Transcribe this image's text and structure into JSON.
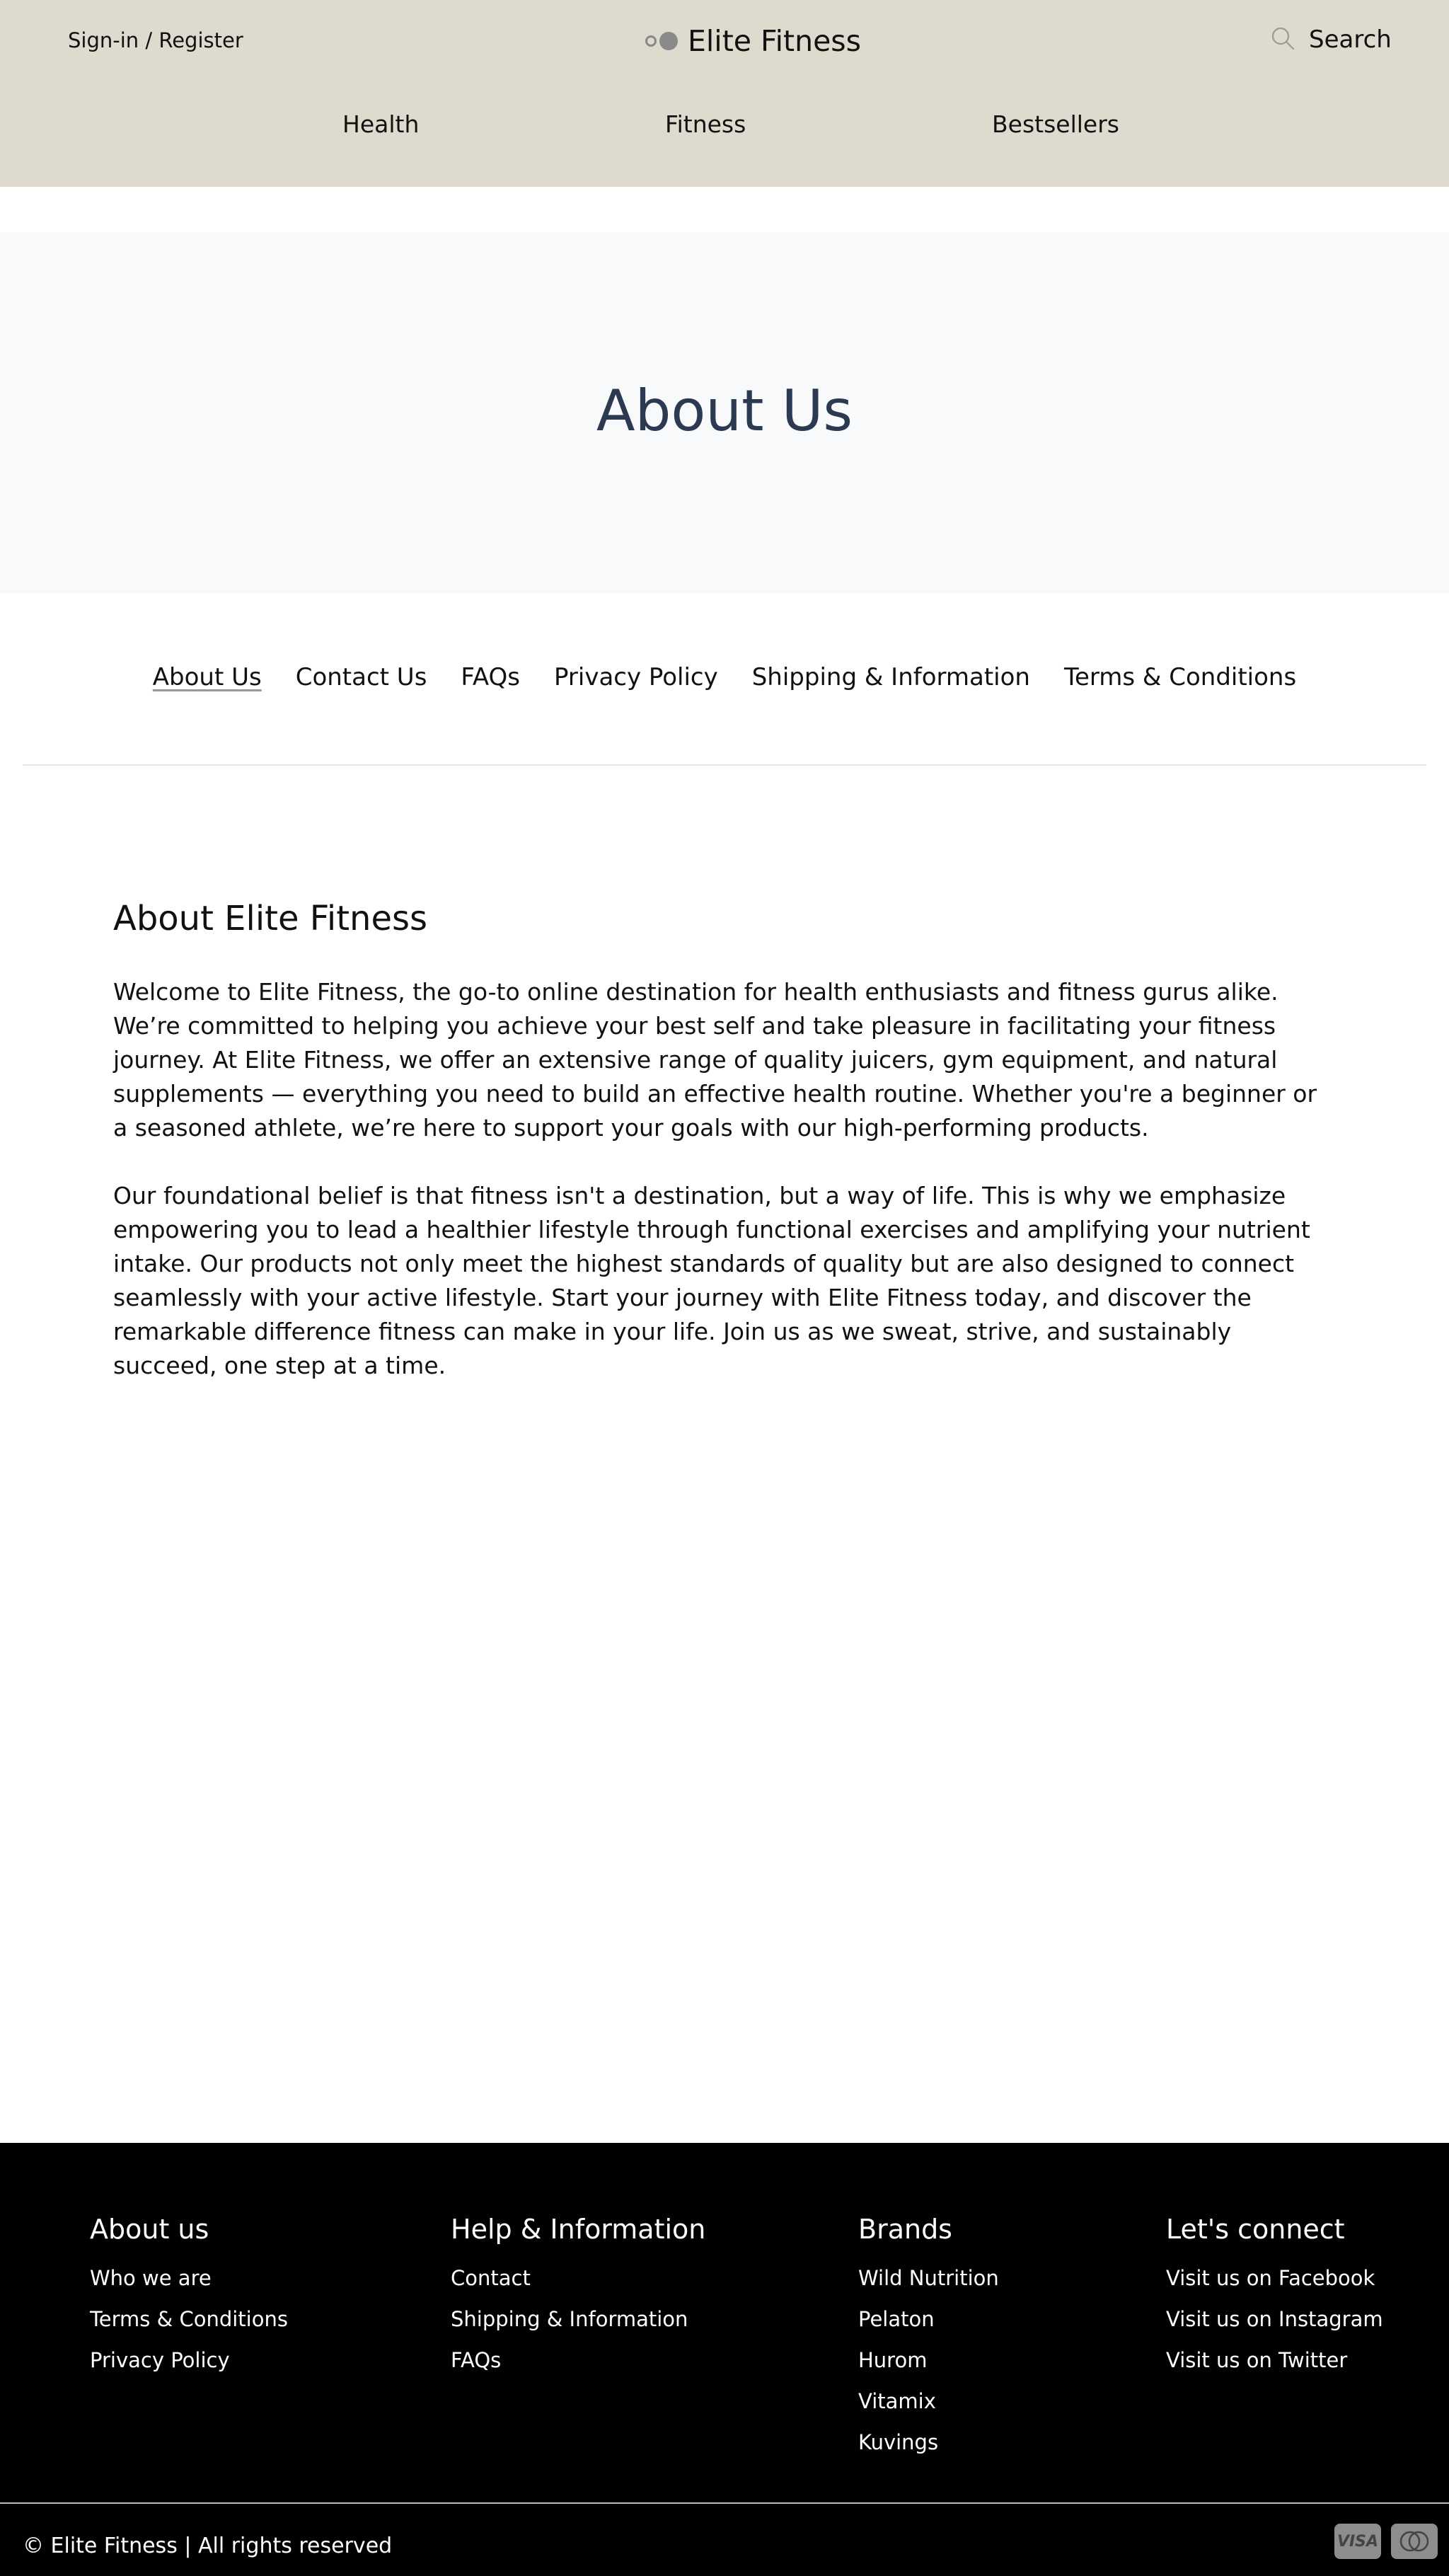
{
  "header": {
    "signin_label": "Sign-in / Register",
    "brand_name": "Elite Fitness",
    "search_label": "Search",
    "nav": [
      "Health",
      "Fitness",
      "Bestsellers"
    ]
  },
  "hero": {
    "title": "About Us"
  },
  "subnav": [
    "About Us",
    "Contact Us",
    "FAQs",
    "Privacy Policy",
    "Shipping & Information",
    "Terms & Conditions"
  ],
  "content": {
    "heading": "About Elite Fitness",
    "paragraphs": [
      "Welcome to Elite Fitness, the go-to online destination for health enthusiasts and fitness gurus alike. We’re committed to helping you achieve your best self and take pleasure in facilitating your fitness journey. At Elite Fitness, we offer an extensive range of quality juicers, gym equipment, and natural supplements — everything you need to build an effective health routine. Whether you're a beginner or a seasoned athlete, we’re here to support your goals with our high-performing products.",
      "Our foundational belief is that fitness isn't a destination, but a way of life. This is why we emphasize empowering you to lead a healthier lifestyle through functional exercises and amplifying your nutrient intake. Our products not only meet the highest standards of quality but are also designed to connect seamlessly with your active lifestyle. Start your journey with Elite Fitness today, and discover the remarkable difference fitness can make in your life. Join us as we sweat, strive, and sustainably succeed, one step at a time."
    ]
  },
  "footer": {
    "columns": [
      {
        "title": "About us",
        "links": [
          "Who we are",
          "Terms & Conditions",
          "Privacy Policy"
        ]
      },
      {
        "title": "Help & Information",
        "links": [
          "Contact",
          "Shipping & Information",
          "FAQs"
        ]
      },
      {
        "title": "Brands",
        "links": [
          "Wild Nutrition",
          "Pelaton",
          "Hurom",
          "Vitamix",
          "Kuvings"
        ]
      },
      {
        "title": "Let's connect",
        "links": [
          "Visit us on Facebook",
          "Visit us on Instagram",
          "Visit us on Twitter"
        ]
      }
    ],
    "copyright": "© Elite Fitness | All rights reserved",
    "payment_icons": [
      "visa-icon",
      "mastercard-icon"
    ],
    "visa_text": "VISA"
  },
  "colors": {
    "header_bg": "#dedace",
    "hero_bg": "#f8f9fa",
    "hero_title": "#2b3a51",
    "footer_bg": "#000000"
  }
}
